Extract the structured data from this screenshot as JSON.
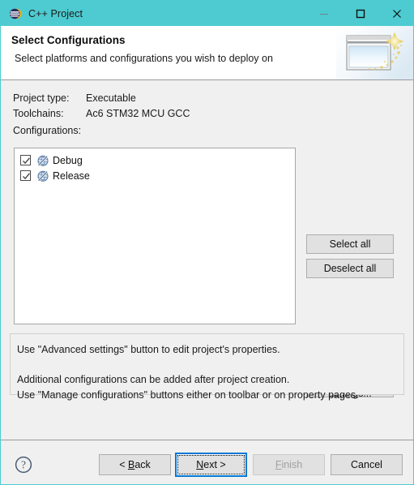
{
  "window": {
    "title": "C++ Project",
    "titlebar_color": "#4dcbd1",
    "app_icon": "eclipse-icon",
    "controls": {
      "minimize": "minimize-icon",
      "maximize": "maximize-icon",
      "close": "close-icon"
    }
  },
  "header": {
    "title": "Select Configurations",
    "subtitle": "Select platforms and configurations you wish to deploy on",
    "banner_icon": "wizard-window-sparkle-icon"
  },
  "form": {
    "project_type_label": "Project type:",
    "project_type_value": "Executable",
    "toolchains_label": "Toolchains:",
    "toolchains_value": "Ac6 STM32 MCU GCC",
    "configurations_label": "Configurations:"
  },
  "configurations": [
    {
      "name": "Debug",
      "checked": true,
      "icon": "configuration-icon"
    },
    {
      "name": "Release",
      "checked": true,
      "icon": "configuration-icon"
    }
  ],
  "side_buttons": {
    "select_all": "Select all",
    "deselect_all": "Deselect all",
    "advanced_settings": "Advanced settings..."
  },
  "info_panel": {
    "line1": "Use \"Advanced settings\" button to edit project's properties.",
    "line2": "Additional configurations can be added after project creation.",
    "line3": "Use \"Manage configurations\" buttons either on toolbar or on property pages."
  },
  "footer": {
    "help_icon": "help-question-icon",
    "back": "< Back",
    "next": "Next >",
    "finish": "Finish",
    "cancel": "Cancel",
    "focused_button": "Next >",
    "disabled_button": "Finish",
    "focus_color": "#0078d7"
  }
}
